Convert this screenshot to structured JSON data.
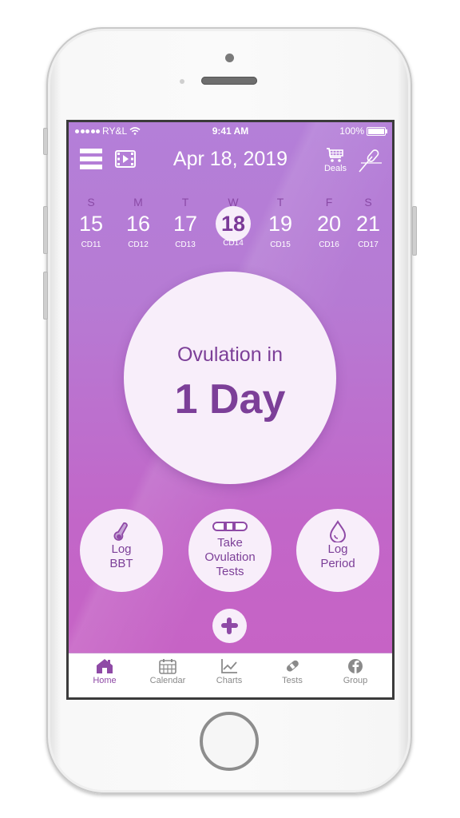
{
  "status_bar": {
    "carrier": "RY&L",
    "time": "9:41 AM",
    "battery": "100%"
  },
  "nav": {
    "title": "Apr 18, 2019",
    "deals_label": "Deals",
    "icons": [
      "menu-icon",
      "video-icon",
      "cart-icon",
      "thermometer-icon"
    ]
  },
  "week": [
    {
      "dow": "S",
      "date": "15",
      "cycle_day": "CD11",
      "selected": false
    },
    {
      "dow": "M",
      "date": "16",
      "cycle_day": "CD12",
      "selected": false
    },
    {
      "dow": "T",
      "date": "17",
      "cycle_day": "CD13",
      "selected": false
    },
    {
      "dow": "W",
      "date": "18",
      "cycle_day": "CD14",
      "selected": true
    },
    {
      "dow": "T",
      "date": "19",
      "cycle_day": "CD15",
      "selected": false
    },
    {
      "dow": "F",
      "date": "20",
      "cycle_day": "CD16",
      "selected": false
    },
    {
      "dow": "S",
      "date": "21",
      "cycle_day": "CD17",
      "selected": false
    }
  ],
  "ovulation": {
    "line1": "Ovulation in",
    "line2": "1 Day"
  },
  "actions": [
    {
      "line1": "Log",
      "line2": "BBT",
      "line3": "",
      "icon": "thermometer-icon"
    },
    {
      "line1": "Take",
      "line2": "Ovulation",
      "line3": "Tests",
      "icon": "test-strip-icon"
    },
    {
      "line1": "Log",
      "line2": "Period",
      "line3": "",
      "icon": "drop-icon"
    }
  ],
  "add_button": {
    "icon": "plus-icon"
  },
  "tabs": [
    {
      "label": "Home",
      "icon": "home-icon",
      "active": true
    },
    {
      "label": "Calendar",
      "icon": "calendar-icon",
      "active": false
    },
    {
      "label": "Charts",
      "icon": "chart-icon",
      "active": false
    },
    {
      "label": "Tests",
      "icon": "bandage-icon",
      "active": false
    },
    {
      "label": "Group",
      "icon": "facebook-icon",
      "active": false
    }
  ],
  "colors": {
    "accent": "#8f4aa6",
    "bg_top": "#b47fd8",
    "bg_bottom": "#c862c4",
    "circle": "#f8eefa",
    "tab_inactive": "#8a8a8a"
  }
}
